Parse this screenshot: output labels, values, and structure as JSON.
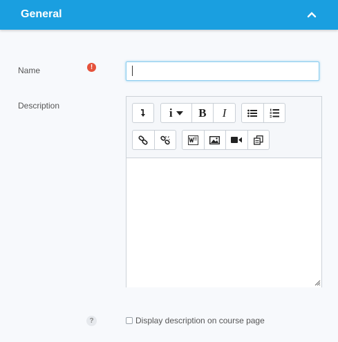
{
  "header": {
    "title": "General",
    "collapse_icon": "chevron-up-icon"
  },
  "form": {
    "name_label": "Name",
    "name_value": "",
    "name_required_icon": "exclamation-icon",
    "description_label": "Description",
    "toolbar": {
      "row1": [
        {
          "name": "collapse-toolbar-button",
          "icon": "arrow-down-return-icon"
        },
        {
          "name": "paragraph-styles-button",
          "icon": "info-dropdown-icon",
          "glyph": "i"
        },
        {
          "name": "bold-button",
          "icon": "bold-icon",
          "glyph": "B"
        },
        {
          "name": "italic-button",
          "icon": "italic-icon",
          "glyph": "I"
        },
        {
          "name": "unordered-list-button",
          "icon": "bullet-list-icon"
        },
        {
          "name": "ordered-list-button",
          "icon": "numbered-list-icon"
        }
      ],
      "row2": [
        {
          "name": "link-button",
          "icon": "link-icon"
        },
        {
          "name": "unlink-button",
          "icon": "unlink-icon"
        },
        {
          "name": "word-import-button",
          "icon": "word-icon"
        },
        {
          "name": "insert-image-button",
          "icon": "image-icon"
        },
        {
          "name": "insert-media-button",
          "icon": "video-icon"
        },
        {
          "name": "manage-files-button",
          "icon": "files-icon"
        }
      ]
    },
    "description_value": "",
    "display_checkbox_checked": false,
    "display_checkbox_label": "Display description on course page",
    "help_icon_glyph": "?"
  },
  "colors": {
    "header": "#1a9fe0",
    "required": "#e5523b",
    "focus_border": "#8ccdf0"
  }
}
